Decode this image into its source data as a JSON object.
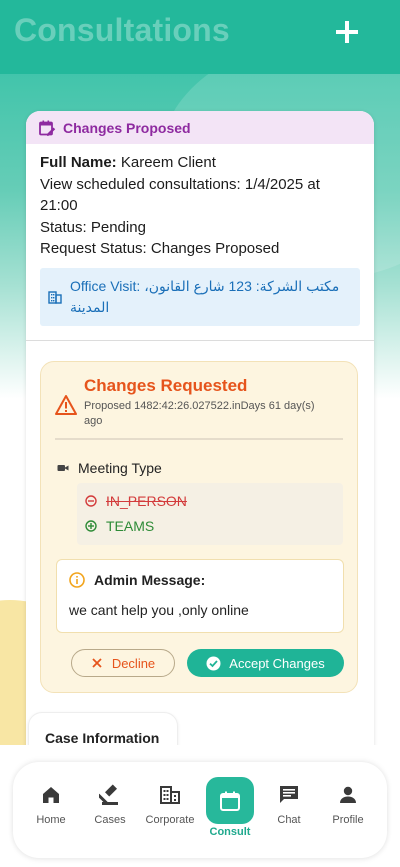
{
  "header": {
    "title": "Consultations",
    "add_icon": "plus-icon"
  },
  "card": {
    "badge": {
      "icon": "calendar-edit-icon",
      "label": "Changes Proposed",
      "color": "#8e2aa0"
    },
    "full_name_label": "Full Name:",
    "full_name_value": " Kareem Client",
    "scheduled": "View scheduled consultations: 1/4/2025 at 21:00",
    "status": "Status: Pending",
    "request_status": "Request Status: Changes Proposed",
    "office_visit": {
      "icon": "office-building-icon",
      "text": "Office Visit: مكتب الشركة: 123 شارع القانون، المدينة"
    }
  },
  "changes": {
    "icon": "warning-icon",
    "title": "Changes Requested",
    "proposed": "Proposed 1482:42:26.027522.inDays 61 day(s) ago",
    "meeting_type_label": "Meeting Type",
    "old_value": "IN_PERSON",
    "new_value": "TEAMS",
    "admin_label": "Admin Message:",
    "admin_message": "we cant help you ,only online",
    "decline_label": "Decline",
    "accept_label": "Accept Changes"
  },
  "case_info": {
    "label": "Case Information"
  },
  "nav": {
    "items": [
      {
        "label": "Home",
        "icon": "home-icon"
      },
      {
        "label": "Cases",
        "icon": "gavel-icon"
      },
      {
        "label": "Corporate",
        "icon": "corporate-icon"
      },
      {
        "label": "Consult",
        "icon": "calendar-icon",
        "active": true
      },
      {
        "label": "Chat",
        "icon": "chat-icon"
      },
      {
        "label": "Profile",
        "icon": "profile-icon"
      }
    ]
  },
  "colors": {
    "primary": "#1fb497",
    "warning": "#e6541c",
    "badge": "#8e2aa0",
    "link": "#1a6fb8"
  }
}
